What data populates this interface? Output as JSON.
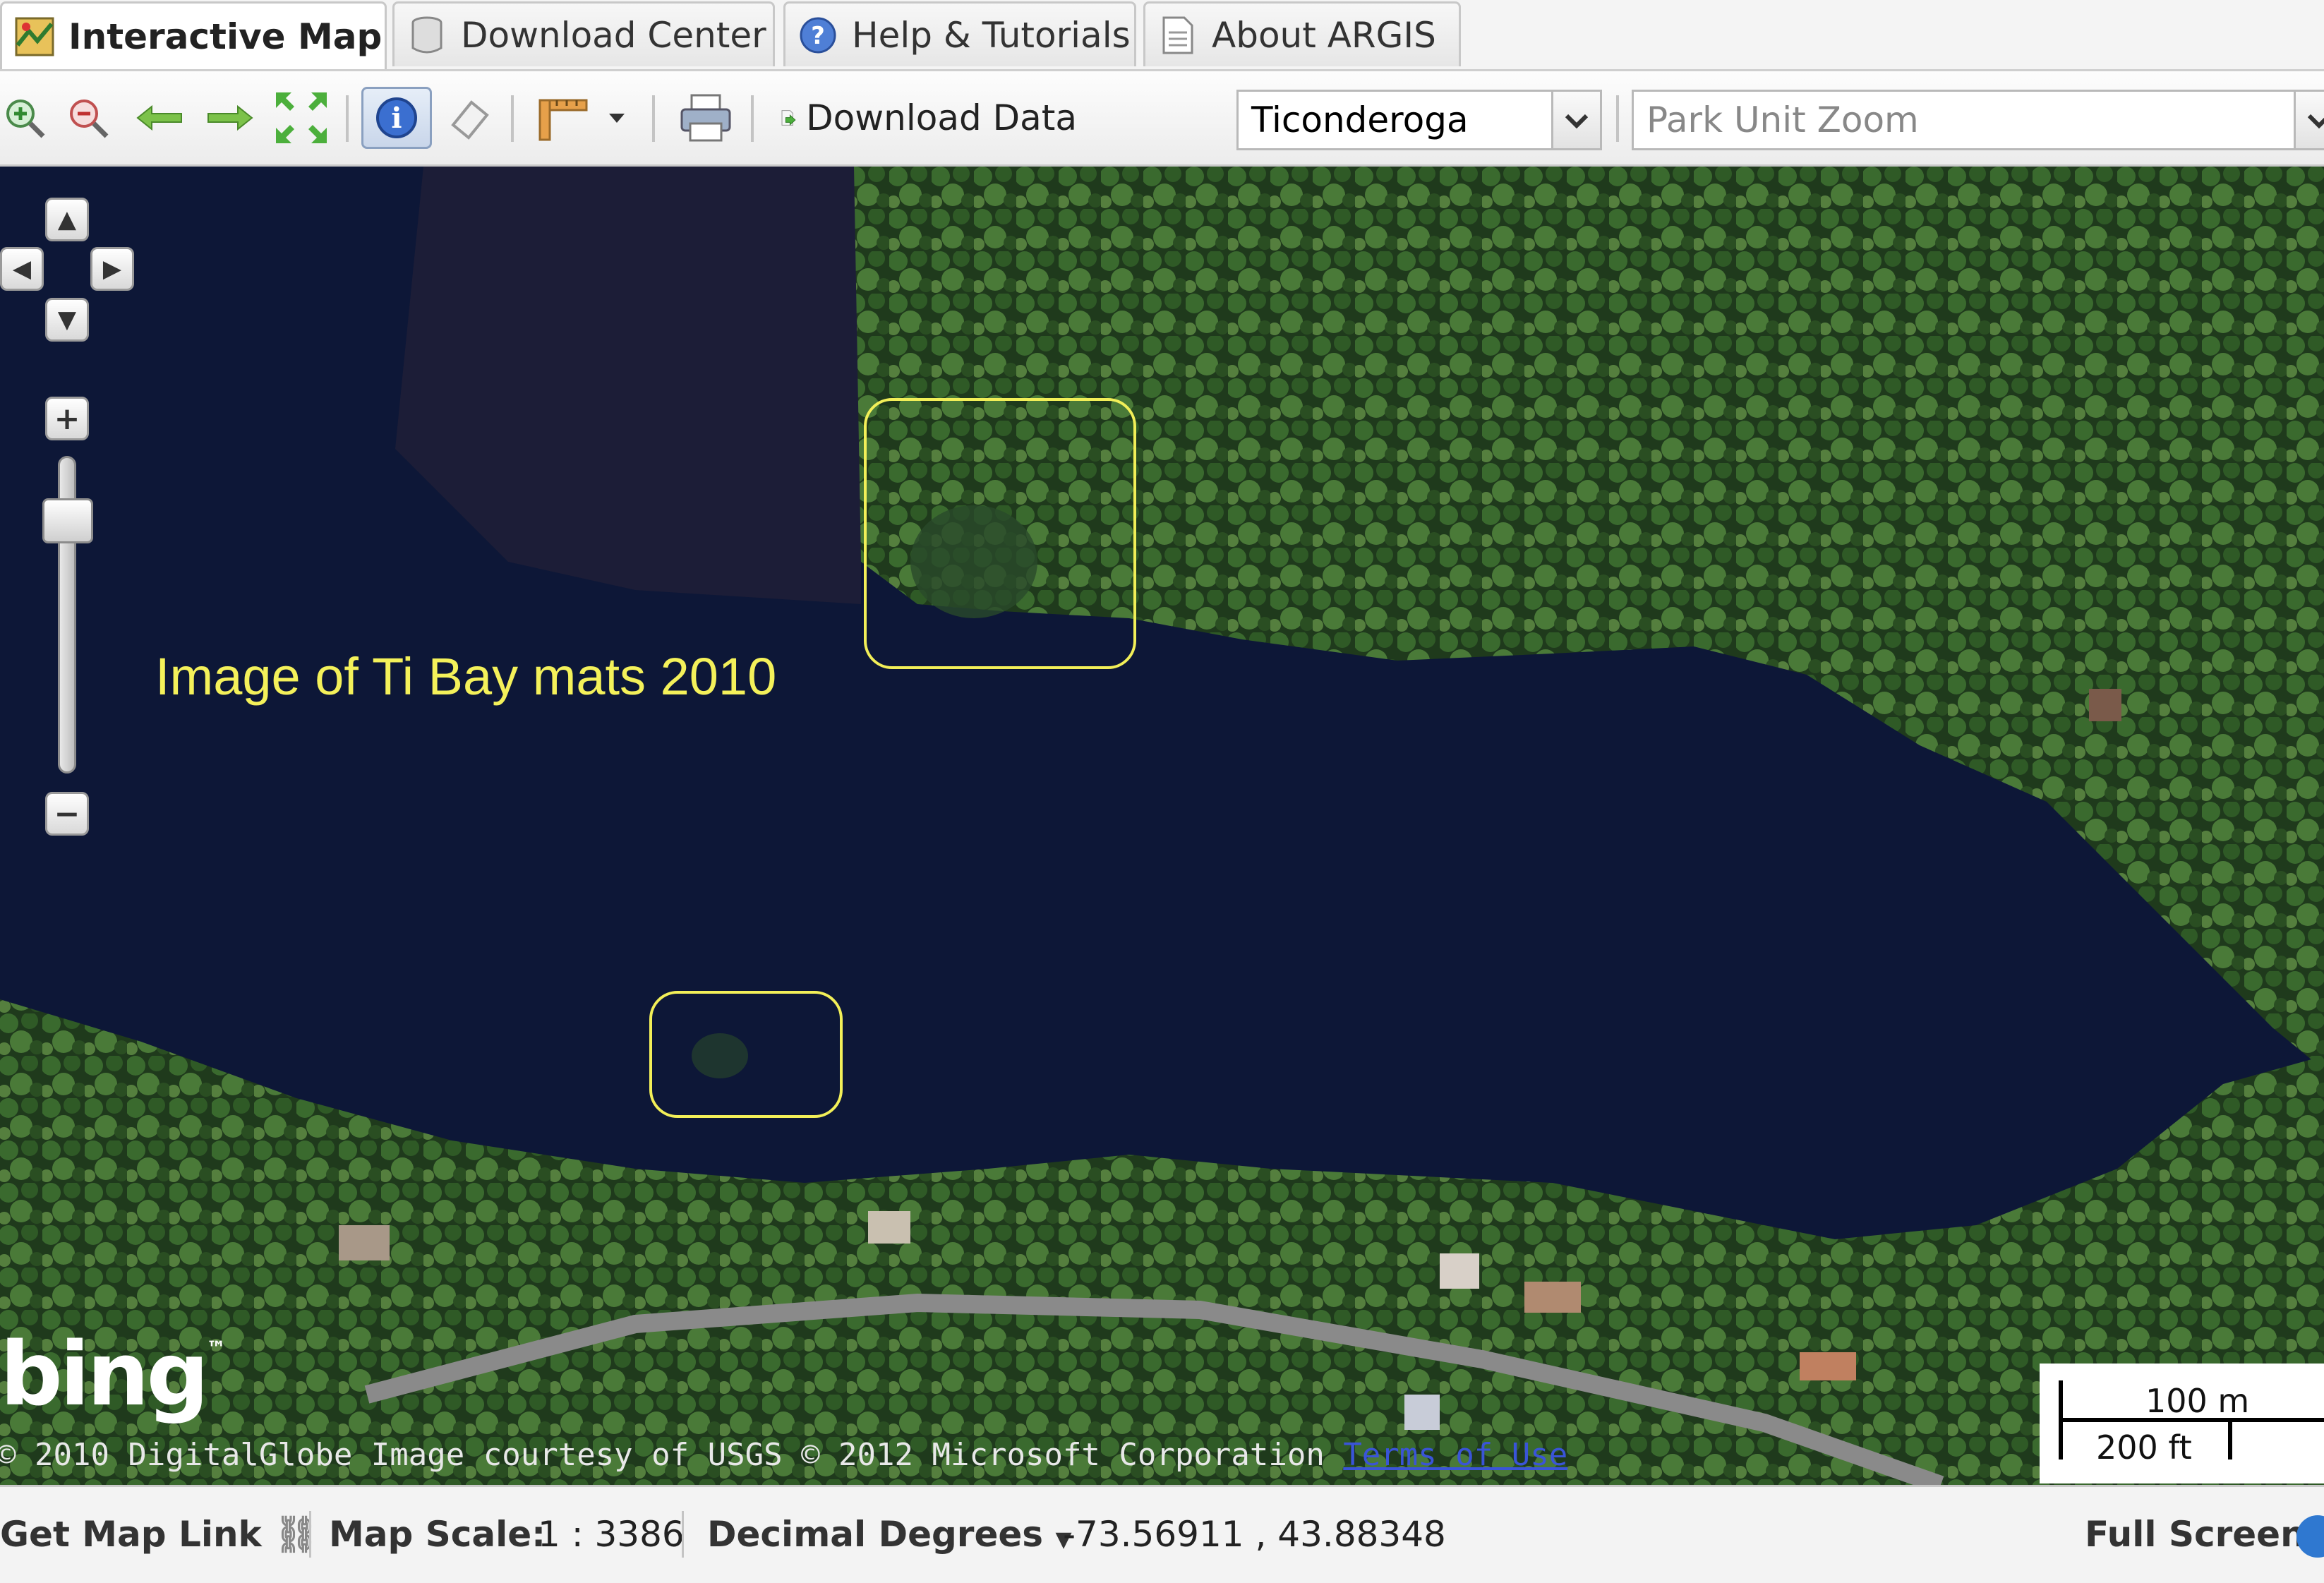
{
  "tabs": [
    {
      "label": "Interactive Map",
      "icon": "map-icon",
      "active": true
    },
    {
      "label": "Download Center",
      "icon": "database-icon",
      "active": false
    },
    {
      "label": "Help & Tutorials",
      "icon": "help-icon",
      "active": false
    },
    {
      "label": "About ARGIS",
      "icon": "document-icon",
      "active": false
    }
  ],
  "toolbar": {
    "download_label": "Download Data",
    "location_value": "Ticonderoga",
    "park_unit_placeholder": "Park Unit Zoom"
  },
  "map": {
    "annotation": "Image of Ti Bay mats 2010",
    "highlight_color": "#f2ef58",
    "logo_text": "bing",
    "logo_tm": "™",
    "copyright": "© 2010 DigitalGlobe Image courtesy of USGS © 2012 Microsoft Corporation",
    "terms_link": "Terms of Use",
    "scale_metric": "100 m",
    "scale_imperial": "200 ft"
  },
  "status_bar": {
    "map_link_label": "Get Map Link",
    "map_scale_label": "Map Scale:",
    "map_scale_value": "1 : 3386",
    "coord_format_label": "Decimal Degrees",
    "coordinates": "-73.56911 , 43.88348",
    "fullscreen_label": "Full Screen"
  }
}
